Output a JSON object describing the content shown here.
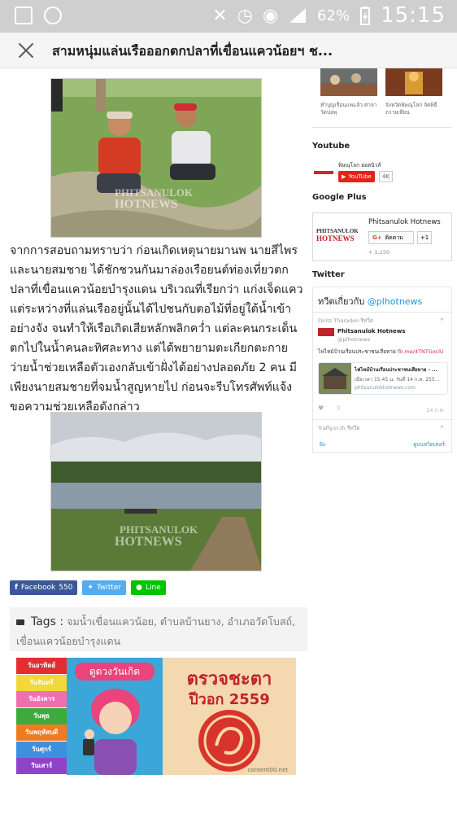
{
  "status_bar": {
    "battery_percent": "62%",
    "time": "15:15"
  },
  "title_bar": {
    "title": "สามหนุ่มแล่นเรือออกตกปลาที่เขื่อนแควน้อยฯ ช..."
  },
  "article": {
    "paragraph": "จากการสอบถามทราบว่า ก่อนเกิดเหตุนายมานพ นายสีไพร และนายสมชาย ได้ชักชวนกันมาล่องเรือยนต์ท่องเที่ยวตกปลาที่เขื่อนแควน้อยบำรุงแดน  บริเวณที่เรียกว่า แก่งเจ็ดแคว แต่ระหว่างที่แล่นเรืออยู่นั้นได้ไปชนกับตอไม้ที่อยู่ใต้น้ำเข้าอย่างจัง จนทำให้เรือเกิดเสียหลักพลิกคว่ำ แต่ละคนกระเด็นตกไปในน้ำคนละทิศละทาง แต่ได้พยายามตะเกียกตะกายว่ายน้ำช่วยเหลือตัวเองกลับเข้าฝั่งได้อย่างปลอดภัย 2 คน มีเพียงนายสมชายที่จมน้ำสูญหายไป ก่อนจะรีบโทรศัพท์แจ้งขอความช่วยเหลือดังกล่าว",
    "watermark_line1": "PHITSANULOK",
    "watermark_line2": "HOTNEWS"
  },
  "share": {
    "facebook_label": "Facebook",
    "facebook_count": "550",
    "twitter_label": "Twitter",
    "line_label": "Line"
  },
  "tags": {
    "label": "Tags :",
    "items": "จมน้ำเขื่อนแควน้อย, ตำบลบ้านยาง, อำเภอวัดโบสถ์, เขื่อนแควน้อยบำรุงแดน"
  },
  "ad": {
    "days": [
      "วันอาทิตย์",
      "วันจันทร์",
      "วันอังคาร",
      "วันพุธ",
      "วันพฤหัสบดี",
      "วันศุกร์",
      "วันเสาร์"
    ],
    "day_colors": [
      "#e52d2d",
      "#f2d83a",
      "#ef6fb0",
      "#3eaa3e",
      "#f07b22",
      "#3d8fe0",
      "#8e44c9"
    ],
    "left_banner": "ดูดวงวันเกิด",
    "right_title": "ตรวจชะตา",
    "right_year": "ปีวอก 2559",
    "site": "content00.net"
  },
  "sidebar": {
    "related": [
      {
        "caption": "ทำบุญเรือนแพแล้ว ศาลาวัดบ่อพุ"
      },
      {
        "caption": "จังหวัดพิษณุโลก จัดพิธีถวายเทียน"
      }
    ],
    "youtube": {
      "heading": "Youtube",
      "channel": "พิษณุโลก ฮอตนิวส์",
      "button": "YouTube",
      "count": "4K"
    },
    "google_plus": {
      "heading": "Google Plus",
      "page_name": "Phitsanulok Hotnews",
      "follow_label": "ติดตาม",
      "plus_one": "+1",
      "count": "+ 1,150",
      "logo_top": "PHITSANULOK",
      "logo_bottom": "HOTNEWS"
    },
    "twitter": {
      "heading": "Twitter",
      "timeline_title": "ทวีตเกี่ยวกับ",
      "handle": "@plhotnews",
      "retweeter": "Diritz Tharadon รีทวีต",
      "account_name": "Phitsanulok Hotnews",
      "account_handle": "@plhotnews",
      "tweet_text": "ไฟไหม้บ้านเรือนประชาชนเสียหาย",
      "tweet_link": "fb.me/4TNTGxclU",
      "card_title": "ไฟไหม้บ้านเรือนประชาชนเสียหาย - ...",
      "card_desc": "เมื่อเวลา 15.45 น. วันที่ 14 ก.ค. 255...",
      "card_domain": "phitsanulokhotnews.com",
      "tweet_date": "14 ก.ค.",
      "retweeter2": "Traffy.in.th รีทวีต",
      "footer_embed": "ฝัง",
      "footer_view": "ดูบนทวิตเตอร์"
    }
  },
  "colors": {
    "facebook": "#3b5998",
    "twitter": "#55acee",
    "line": "#00c300",
    "youtube_red": "#e62117",
    "twitter_link": "#1b95e0",
    "status_bar": "#cfcfcf"
  }
}
